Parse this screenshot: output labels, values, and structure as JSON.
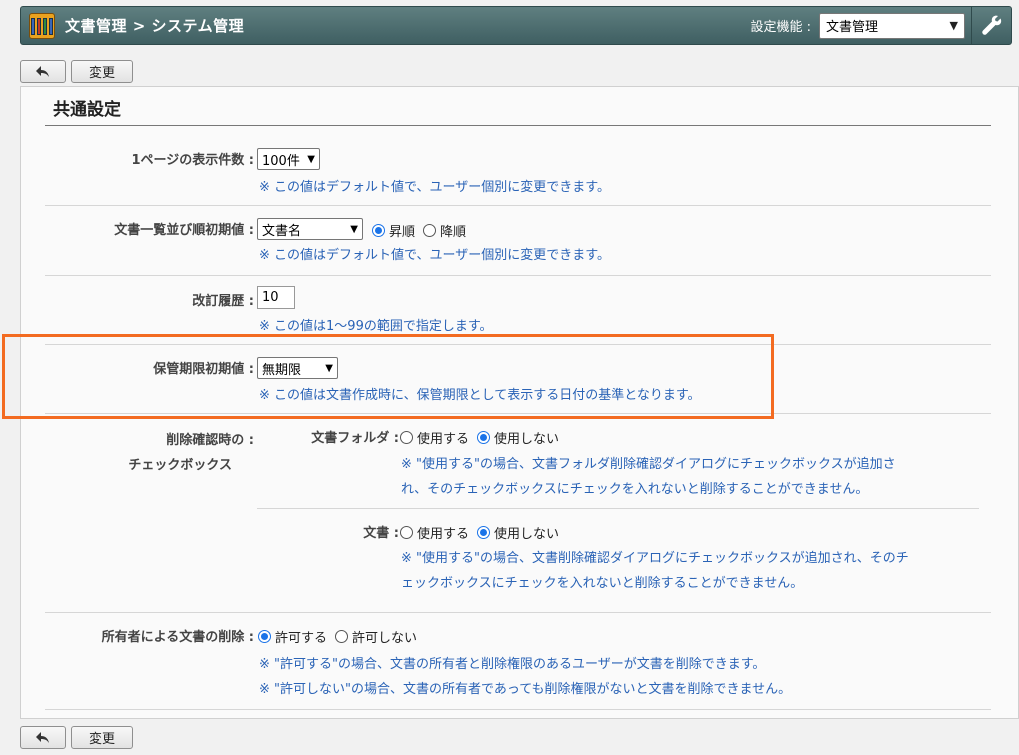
{
  "header": {
    "title": "文書管理 > システム管理",
    "setting_label": "設定機能 :",
    "setting_value": "文書管理",
    "icons": {
      "logo": "binders-logo-icon",
      "tools": "wrench-icon"
    }
  },
  "toolbar": {
    "back_icon": "back-arrow-icon",
    "change_label": "変更"
  },
  "section_title": "共通設定",
  "rows": {
    "page_count": {
      "label": "1ページの表示件数 :",
      "value": "100件",
      "note": "※ この値はデフォルト値で、ユーザー個別に変更できます。"
    },
    "sort": {
      "label": "文書一覧並び順初期値 :",
      "value": "文書名",
      "asc": "昇順",
      "desc": "降順",
      "selected": "昇順",
      "note": "※ この値はデフォルト値で、ユーザー個別に変更できます。"
    },
    "revision": {
      "label": "改訂履歴 :",
      "value": "10",
      "note": "※ この値は1～99の範囲で指定します。"
    },
    "retention": {
      "label": "保管期限初期値 :",
      "value": "無期限",
      "note": "※ この値は文書作成時に、保管期限として表示する日付の基準となります。"
    },
    "delete_confirm": {
      "label_line1": "削除確認時の :",
      "label_line2": "チェックボックス",
      "folder": {
        "label": "文書フォルダ :",
        "use": "使用する",
        "not_use": "使用しない",
        "selected": "使用しない",
        "note_line1": "※ \"使用する\"の場合、文書フォルダ削除確認ダイアログにチェックボックスが追加さ",
        "note_line2": "れ、そのチェックボックスにチェックを入れないと削除することができません。"
      },
      "document": {
        "label": "文書 :",
        "use": "使用する",
        "not_use": "使用しない",
        "selected": "使用しない",
        "note_line1": "※ \"使用する\"の場合、文書削除確認ダイアログにチェックボックスが追加され、そのチ",
        "note_line2": "ェックボックスにチェックを入れないと削除することができません。"
      }
    },
    "owner_delete": {
      "label": "所有者による文書の削除 :",
      "allow": "許可する",
      "disallow": "許可しない",
      "selected": "許可する",
      "note_line1": "※ \"許可する\"の場合、文書の所有者と削除権限のあるユーザーが文書を削除できます。",
      "note_line2": "※ \"許可しない\"の場合、文書の所有者であっても削除権限がないと文書を削除できません。"
    }
  },
  "colors": {
    "header": "#4f6f71",
    "note": "#2a63b6",
    "highlight": "#f36b21",
    "radio_on": "#1a73e8"
  }
}
